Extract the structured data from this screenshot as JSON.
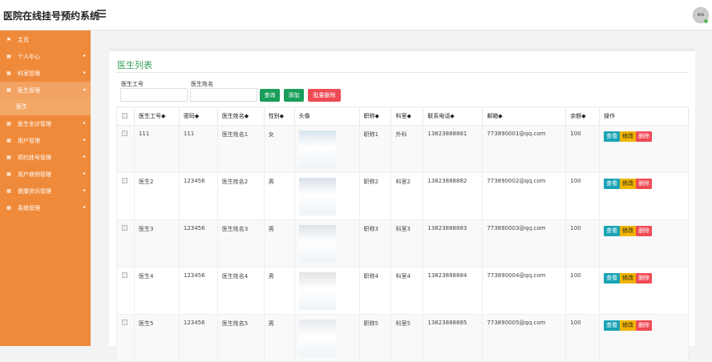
{
  "header": {
    "title": "医院在线挂号预约系统",
    "avatar_text": "BMS"
  },
  "sidebar": {
    "home": "主页",
    "items": [
      {
        "label": "个人中心",
        "icon": "grid-icon"
      },
      {
        "label": "科室管理",
        "icon": "grid-icon"
      },
      {
        "label": "医生管理",
        "icon": "grid-icon",
        "expanded": true,
        "children": [
          "医生"
        ]
      },
      {
        "label": "医生坐诊管理",
        "icon": "grid-icon"
      },
      {
        "label": "用户管理",
        "icon": "grid-icon"
      },
      {
        "label": "预约挂号管理",
        "icon": "grid-icon"
      },
      {
        "label": "用户病例管理",
        "icon": "grid-icon"
      },
      {
        "label": "健康资讯管理",
        "icon": "grid-icon"
      },
      {
        "label": "系统管理",
        "icon": "grid-icon"
      }
    ]
  },
  "main": {
    "page_title": "医生列表",
    "search": {
      "id_label": "医生工号",
      "id_value": "",
      "name_label": "医生姓名",
      "name_value": "",
      "query_btn": "查询",
      "add_btn": "添加",
      "batch_delete_btn": "批量删除"
    },
    "table": {
      "columns": [
        "医生工号◆",
        "密码◆",
        "医生姓名◆",
        "性别◆",
        "头像",
        "职称◆",
        "科室◆",
        "联系电话◆",
        "邮箱◆",
        "余额◆",
        "操作"
      ],
      "rows": [
        {
          "id": "111",
          "pwd": "111",
          "name": "医生姓名1",
          "sex": "女",
          "title": "职称1",
          "dept": "外科",
          "phone": "13823888881",
          "email": "773890001@qq.com",
          "balance": "100"
        },
        {
          "id": "医生2",
          "pwd": "123456",
          "name": "医生姓名2",
          "sex": "男",
          "title": "职称2",
          "dept": "科室2",
          "phone": "13823888882",
          "email": "773890002@qq.com",
          "balance": "100"
        },
        {
          "id": "医生3",
          "pwd": "123456",
          "name": "医生姓名3",
          "sex": "男",
          "title": "职称3",
          "dept": "科室3",
          "phone": "13823888883",
          "email": "773890003@qq.com",
          "balance": "100"
        },
        {
          "id": "医生4",
          "pwd": "123456",
          "name": "医生姓名4",
          "sex": "男",
          "title": "职称4",
          "dept": "科室4",
          "phone": "13823888884",
          "email": "773890004@qq.com",
          "balance": "100"
        },
        {
          "id": "医生5",
          "pwd": "123456",
          "name": "医生姓名5",
          "sex": "男",
          "title": "职称5",
          "dept": "科室5",
          "phone": "13823888885",
          "email": "773890005@qq.com",
          "balance": "100"
        }
      ],
      "ops": {
        "view": "查看",
        "edit": "修改",
        "del": "删除"
      }
    }
  },
  "colors": {
    "sidebar": "#ef8a3a",
    "accent_green": "#3aa05a",
    "btn_green": "#1a9e5a",
    "btn_red": "#f04a55",
    "btn_view": "#1aa3b5",
    "btn_edit": "#f0b400"
  }
}
